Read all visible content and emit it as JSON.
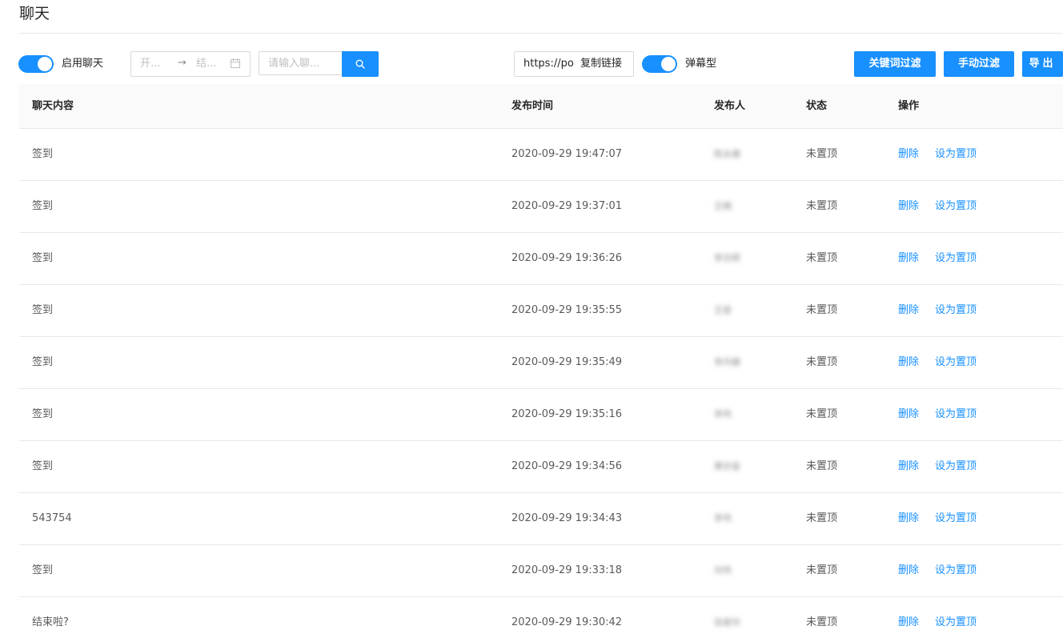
{
  "page": {
    "title": "聊天"
  },
  "toolbar": {
    "enable_chat_label": "启用聊天",
    "date_range": {
      "start_placeholder": "开...",
      "arrow": "→",
      "end_placeholder": "结..."
    },
    "search_placeholder": "请输入聊...",
    "link_url": "https://po",
    "copy_link_label": "复制链接",
    "danmaku_label": "弹幕型",
    "keyword_filter_label": "关键词过滤",
    "manual_filter_label": "手动过滤",
    "export_label": "导出"
  },
  "table": {
    "columns": [
      "聊天内容",
      "发布时间",
      "发布人",
      "状态",
      "操作"
    ],
    "rows": [
      {
        "content": "签到",
        "time": "2020-09-29 19:47:07",
        "sender": "陈永康",
        "status": "未置顶",
        "delete": "删除",
        "pin": "设为置顶"
      },
      {
        "content": "签到",
        "time": "2020-09-29 19:37:01",
        "sender": "王楠",
        "status": "未置顶",
        "delete": "删除",
        "pin": "设为置顶"
      },
      {
        "content": "签到",
        "time": "2020-09-29 19:36:26",
        "sender": "李日晖",
        "status": "未置顶",
        "delete": "删除",
        "pin": "设为置顶"
      },
      {
        "content": "签到",
        "time": "2020-09-29 19:35:55",
        "sender": "王俊",
        "status": "未置顶",
        "delete": "删除",
        "pin": "设为置顶"
      },
      {
        "content": "签到",
        "time": "2020-09-29 19:35:49",
        "sender": "李丹娜",
        "status": "未置顶",
        "delete": "删除",
        "pin": "设为置顶"
      },
      {
        "content": "签到",
        "time": "2020-09-29 19:35:16",
        "sender": "李伟",
        "status": "未置顶",
        "delete": "删除",
        "pin": "设为置顶"
      },
      {
        "content": "签到",
        "time": "2020-09-29 19:34:56",
        "sender": "黄宗金",
        "status": "未置顶",
        "delete": "删除",
        "pin": "设为置顶"
      },
      {
        "content": "543754",
        "time": "2020-09-29 19:34:43",
        "sender": "李伟",
        "status": "未置顶",
        "delete": "删除",
        "pin": "设为置顶"
      },
      {
        "content": "签到",
        "time": "2020-09-29 19:33:18",
        "sender": "刘伟",
        "status": "未置顶",
        "delete": "删除",
        "pin": "设为置顶"
      },
      {
        "content": "结束啦?",
        "time": "2020-09-29 19:30:42",
        "sender": "张家玲",
        "status": "未置顶",
        "delete": "删除",
        "pin": "设为置顶"
      }
    ]
  },
  "colors": {
    "primary": "#1890ff",
    "border": "#e8e8e8",
    "header_bg": "#fafafa"
  },
  "icons": {
    "calendar": "calendar-icon",
    "search": "search-icon"
  }
}
